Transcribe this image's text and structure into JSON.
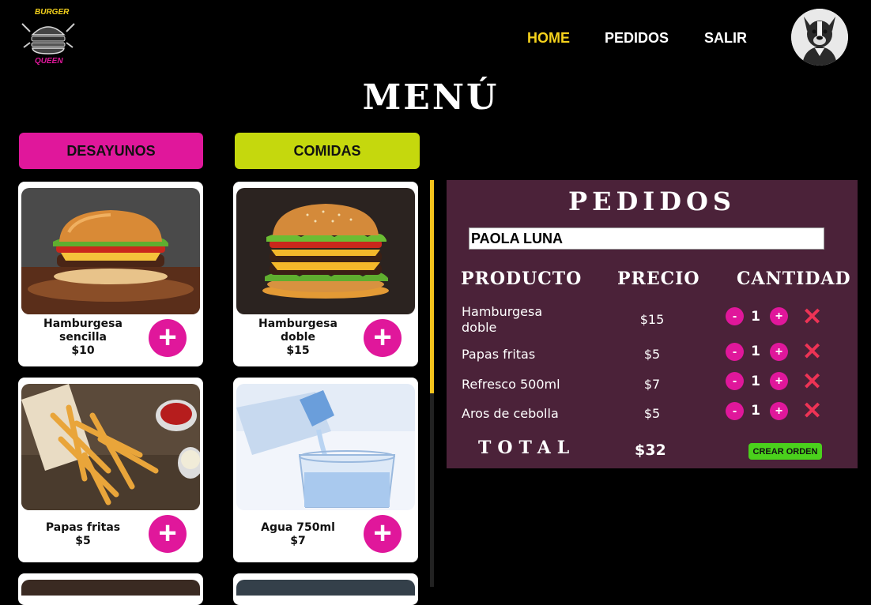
{
  "header": {
    "logo_line1": "BURGER",
    "logo_line2": "QUEEN",
    "nav": [
      {
        "label": "HOME",
        "active": true
      },
      {
        "label": "PEDIDOS",
        "active": false
      },
      {
        "label": "SALIR",
        "active": false
      }
    ]
  },
  "page_title": "MENÚ",
  "categories": [
    {
      "label": "DESAYUNOS",
      "color": "#e0179b"
    },
    {
      "label": "COMIDAS",
      "color": "#c5d80d"
    }
  ],
  "products": [
    {
      "name": "Hamburgesa sencilla",
      "price": "$10"
    },
    {
      "name": "Hamburgesa doble",
      "price": "$15"
    },
    {
      "name": "Papas fritas",
      "price": "$5"
    },
    {
      "name": "Agua 750ml",
      "price": "$7"
    }
  ],
  "order": {
    "title": "PEDIDOS",
    "client_name": "PAOLA LUNA",
    "columns": [
      "PRODUCTO",
      "PRECIO",
      "CANTIDAD"
    ],
    "items": [
      {
        "name": "Hamburgesa doble",
        "price": "$15",
        "qty": "1"
      },
      {
        "name": "Papas fritas",
        "price": "$5",
        "qty": "1"
      },
      {
        "name": "Refresco 500ml",
        "price": "$7",
        "qty": "1"
      },
      {
        "name": "Aros de cebolla",
        "price": "$5",
        "qty": "1"
      }
    ],
    "total_label": "TOTAL",
    "total_value": "$32",
    "create_label": "CREAR ORDEN"
  },
  "colors": {
    "accent_pink": "#e0179b",
    "accent_yellow": "#f5d21c",
    "accent_lime": "#c5d80d",
    "panel_bg": "#4b2239",
    "create_green": "#4ad11c",
    "remove_red": "#ee3355"
  },
  "icons": [
    "burger-logo-icon",
    "dog-avatar",
    "plus-icon",
    "minus-icon",
    "close-icon"
  ]
}
